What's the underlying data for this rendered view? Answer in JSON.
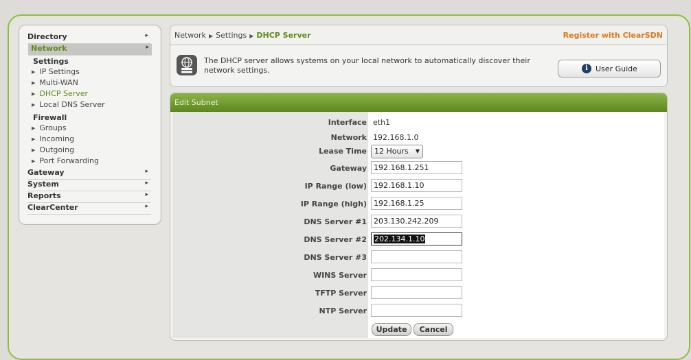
{
  "sidebar": {
    "sections": {
      "directory": "Directory",
      "network": "Network",
      "gateway": "Gateway",
      "system": "System",
      "reports": "Reports",
      "clearcenter": "ClearCenter"
    },
    "network_groups": {
      "settings": "Settings",
      "firewall": "Firewall"
    },
    "settings_items": [
      "IP Settings",
      "Multi-WAN",
      "DHCP Server",
      "Local DNS Server"
    ],
    "firewall_items": [
      "Groups",
      "Incoming",
      "Outgoing",
      "Port Forwarding"
    ],
    "active_item": "DHCP Server"
  },
  "breadcrumb": {
    "items": [
      "Network",
      "Settings",
      "DHCP Server"
    ]
  },
  "register_link": "Register with ClearSDN",
  "info": {
    "text": "The DHCP server allows systems on your local network to automatically discover their network settings.",
    "icon": "network-server-icon",
    "user_guide_label": "User Guide"
  },
  "edit_subnet": {
    "title": "Edit Subnet",
    "fields": {
      "interface": {
        "label": "Interface",
        "value": "eth1"
      },
      "network": {
        "label": "Network",
        "value": "192.168.1.0"
      },
      "lease_time": {
        "label": "Lease Time",
        "value": "12 Hours"
      },
      "gateway": {
        "label": "Gateway",
        "value": "192.168.1.251"
      },
      "ip_range_low": {
        "label": "IP Range (low)",
        "value": "192.168.1.10"
      },
      "ip_range_high": {
        "label": "IP Range (high)",
        "value": "192.168.1.25"
      },
      "dns1": {
        "label": "DNS Server #1",
        "value": "203.130.242.209"
      },
      "dns2": {
        "label": "DNS Server #2",
        "value": "202.134.1.10"
      },
      "dns3": {
        "label": "DNS Server #3",
        "value": ""
      },
      "wins": {
        "label": "WINS Server",
        "value": ""
      },
      "tftp": {
        "label": "TFTP Server",
        "value": ""
      },
      "ntp": {
        "label": "NTP Server",
        "value": ""
      }
    },
    "update_label": "Update",
    "cancel_label": "Cancel"
  },
  "colors": {
    "accent_green": "#5b8f16",
    "header_green": "#6f9a2a",
    "register_orange": "#d87a1b",
    "frame_green": "#8fbf3a"
  }
}
